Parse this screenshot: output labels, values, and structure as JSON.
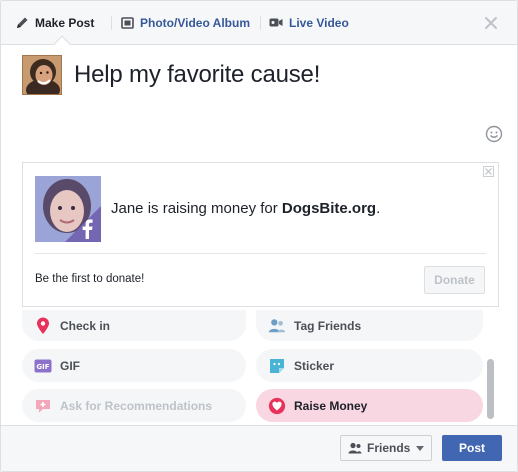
{
  "tabs": [
    {
      "label": "Make Post",
      "icon": "pencil-icon"
    },
    {
      "label": "Photo/Video Album",
      "icon": "album-icon"
    },
    {
      "label": "Live Video",
      "icon": "video-camera-icon"
    }
  ],
  "close_icon": "close-icon",
  "post": {
    "text": "Help my favorite cause!",
    "avatar_icon": "avatar",
    "emoji_icon": "smiley-icon"
  },
  "fundraiser": {
    "text_prefix": "Jane is raising money for ",
    "org": "DogsBite.org",
    "text_suffix": ".",
    "first_donate": "Be the first to donate!",
    "donate_label": "Donate",
    "badge_icon": "facebook-f-icon"
  },
  "actions": [
    {
      "label": "Check in",
      "icon": "location-pin-icon",
      "color": "#e9325b"
    },
    {
      "label": "Tag Friends",
      "icon": "tag-friends-icon",
      "color": "#6e9ec8"
    },
    {
      "label": "GIF",
      "icon": "gif-icon",
      "color": "#8c72cb"
    },
    {
      "label": "Sticker",
      "icon": "sticker-icon",
      "color": "#4ab4d6"
    },
    {
      "label": "Ask for Recommendations",
      "icon": "recommendations-icon",
      "color": "#f2a8b8"
    },
    {
      "label": "Raise Money",
      "icon": "raise-money-icon",
      "color": "#e9325b"
    }
  ],
  "footer": {
    "audience_label": "Friends",
    "post_label": "Post"
  },
  "colors": {
    "brand_blue": "#4267b2",
    "link_blue": "#365899",
    "active_pill": "#f8d6e2"
  }
}
